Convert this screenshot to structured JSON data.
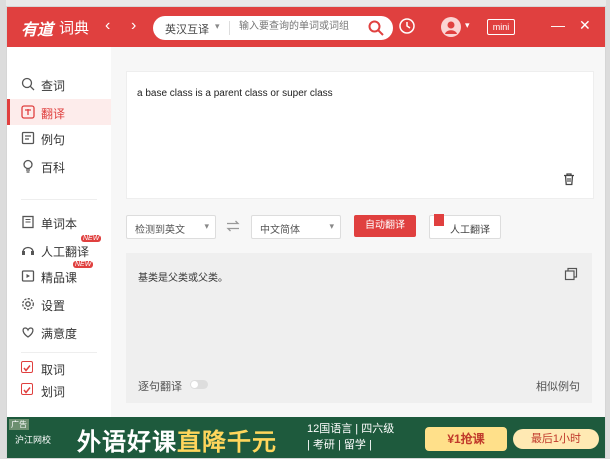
{
  "titlebar": {
    "logo": "有道",
    "logo_sub": "词典",
    "nav_back": "‹",
    "nav_forward": "›",
    "search_mode": "英汉互译",
    "search_placeholder": "输入要查询的单词或词组",
    "mini_label": "mini",
    "minimize": "—",
    "close": "✕",
    "accent": "#e0403f"
  },
  "sidebar": {
    "items": [
      {
        "label": "查词",
        "icon": "search-icon"
      },
      {
        "label": "翻译",
        "icon": "translate-icon",
        "active": true
      },
      {
        "label": "例句",
        "icon": "example-icon"
      },
      {
        "label": "百科",
        "icon": "encyclopedia-icon"
      },
      {
        "label": "单词本",
        "icon": "wordbook-icon"
      },
      {
        "label": "人工翻译",
        "icon": "human-translate-icon",
        "badge": "NEW"
      },
      {
        "label": "精品课",
        "icon": "course-icon",
        "badge": "NEW"
      },
      {
        "label": "设置",
        "icon": "gear-icon"
      },
      {
        "label": "满意度",
        "icon": "heart-icon"
      },
      {
        "label": "取词",
        "icon": "checkbox-icon",
        "checked": true
      },
      {
        "label": "划词",
        "icon": "checkbox-icon",
        "checked": true
      }
    ]
  },
  "translate": {
    "input_text": "a base class is a parent class or super class",
    "source_lang": "检测到英文",
    "target_lang": "中文简体",
    "auto_button": "自动翻译",
    "human_button": "人工翻译",
    "output_text": "基类是父类或父类。",
    "sentence_toggle_label": "逐句翻译",
    "similar_examples": "相似例句"
  },
  "ad": {
    "tag": "广告",
    "logo": "沪江网校",
    "headline_a": "外语好课",
    "headline_b": "直降千元",
    "tags_line1": "12国语言 | 四六级",
    "tags_line2": "| 考研 | 留学 |",
    "cta": "¥1抢课",
    "cta2": "最后1小时"
  }
}
